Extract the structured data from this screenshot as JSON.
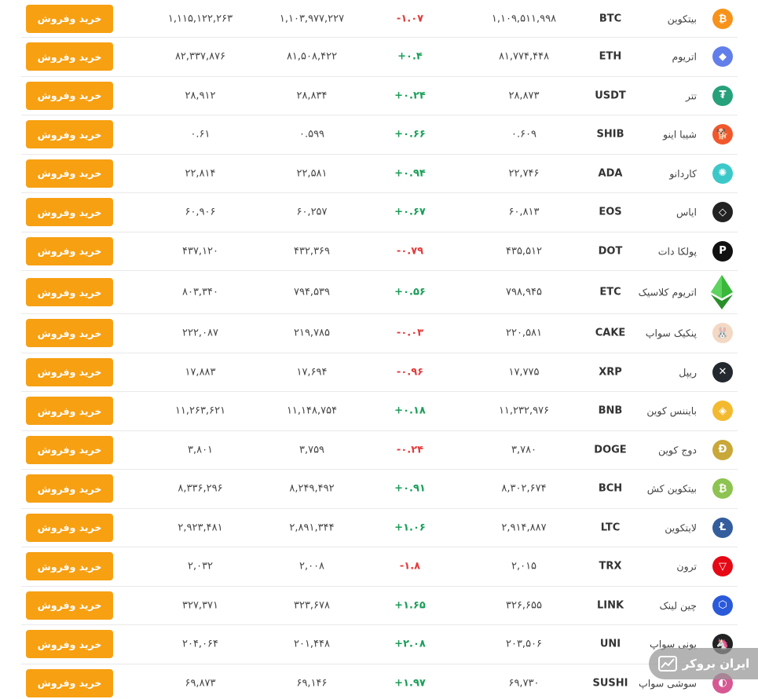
{
  "button_label": "خرید وفروش",
  "watermark": {
    "text": "ایران بروکر",
    "logo_icon": "chart-trend-icon"
  },
  "colors": {
    "accent": "#f7a012",
    "up": "#1a9e58",
    "down": "#e23b3b"
  },
  "rows": [
    {
      "name": "بیتکوین",
      "symbol": "BTC",
      "price": "۱,۱۰۹,۵۱۱,۹۹۸",
      "change": "-۱.۰۷",
      "trend": "down",
      "buy": "۱,۱۰۳,۹۷۷,۲۲۷",
      "sell": "۱,۱۱۵,۱۲۲,۲۶۳",
      "icon": "bitcoin-icon",
      "color": "#f7931a",
      "glyph": "₿"
    },
    {
      "name": "اتریوم",
      "symbol": "ETH",
      "price": "۸۱,۷۷۴,۴۴۸",
      "change": "+۰.۴",
      "trend": "up",
      "buy": "۸۱,۵۰۸,۴۲۲",
      "sell": "۸۲,۳۳۷,۸۷۶",
      "icon": "ethereum-icon",
      "color": "#627eea",
      "glyph": "◆"
    },
    {
      "name": "تتر",
      "symbol": "USDT",
      "price": "۲۸,۸۷۳",
      "change": "+۰.۲۴",
      "trend": "up",
      "buy": "۲۸,۸۳۴",
      "sell": "۲۸,۹۱۲",
      "icon": "tether-icon",
      "color": "#26a17b",
      "glyph": "₮"
    },
    {
      "name": "شیبا اینو",
      "symbol": "SHIB",
      "price": "۰.۶۰۹",
      "change": "+۰.۶۶",
      "trend": "up",
      "buy": "۰.۵۹۹",
      "sell": "۰.۶۱",
      "icon": "shiba-inu-icon",
      "color": "#f0582c",
      "glyph": "🐕"
    },
    {
      "name": "کاردانو",
      "symbol": "ADA",
      "price": "۲۲,۷۴۶",
      "change": "+۰.۹۴",
      "trend": "up",
      "buy": "۲۲,۵۸۱",
      "sell": "۲۲,۸۱۴",
      "icon": "cardano-icon",
      "color": "#3cc8c8",
      "glyph": "✺"
    },
    {
      "name": "ایاس",
      "symbol": "EOS",
      "price": "۶۰,۸۱۳",
      "change": "+۰.۶۷",
      "trend": "up",
      "buy": "۶۰,۲۵۷",
      "sell": "۶۰,۹۰۶",
      "icon": "eos-icon",
      "color": "#222222",
      "glyph": "◇"
    },
    {
      "name": "پولکا دات",
      "symbol": "DOT",
      "price": "۴۳۵,۵۱۲",
      "change": "-۰.۷۹",
      "trend": "down",
      "buy": "۴۳۲,۳۶۹",
      "sell": "۴۳۷,۱۲۰",
      "icon": "polkadot-icon",
      "color": "#111111",
      "glyph": "P"
    },
    {
      "name": "اتریوم کلاسیک",
      "symbol": "ETC",
      "price": "۷۹۸,۹۴۵",
      "change": "+۰.۵۶",
      "trend": "up",
      "buy": "۷۹۴,۵۳۹",
      "sell": "۸۰۳,۳۴۰",
      "icon": "ethereum-classic-icon",
      "color": "#3ab83a",
      "glyph": ""
    },
    {
      "name": "پنکیک سواپ",
      "symbol": "CAKE",
      "price": "۲۲۰,۵۸۱",
      "change": "-۰.۰۳",
      "trend": "down",
      "buy": "۲۱۹,۷۸۵",
      "sell": "۲۲۲,۰۸۷",
      "icon": "pancakeswap-icon",
      "color": "#f3d8c3",
      "glyph": "🐰"
    },
    {
      "name": "ریپل",
      "symbol": "XRP",
      "price": "۱۷,۷۷۵",
      "change": "-۰.۹۶",
      "trend": "down",
      "buy": "۱۷,۶۹۴",
      "sell": "۱۷,۸۸۳",
      "icon": "ripple-icon",
      "color": "#23292f",
      "glyph": "✕"
    },
    {
      "name": "بایننس کوین",
      "symbol": "BNB",
      "price": "۱۱,۲۳۲,۹۷۶",
      "change": "+۰.۱۸",
      "trend": "up",
      "buy": "۱۱,۱۴۸,۷۵۴",
      "sell": "۱۱,۲۶۳,۶۲۱",
      "icon": "binance-icon",
      "color": "#f3ba2f",
      "glyph": "◈"
    },
    {
      "name": "دوج کوین",
      "symbol": "DOGE",
      "price": "۳,۷۸۰",
      "change": "-۰.۲۴",
      "trend": "down",
      "buy": "۳,۷۵۹",
      "sell": "۳,۸۰۱",
      "icon": "dogecoin-icon",
      "color": "#c9a83a",
      "glyph": "Ð"
    },
    {
      "name": "بیتکوین کش",
      "symbol": "BCH",
      "price": "۸,۳۰۲,۶۷۴",
      "change": "+۰.۹۱",
      "trend": "up",
      "buy": "۸,۲۴۹,۴۹۲",
      "sell": "۸,۳۳۶,۲۹۶",
      "icon": "bitcoin-cash-icon",
      "color": "#8dc351",
      "glyph": "₿"
    },
    {
      "name": "لایتکوین",
      "symbol": "LTC",
      "price": "۲,۹۱۴,۸۸۷",
      "change": "+۱.۰۶",
      "trend": "up",
      "buy": "۲,۸۹۱,۳۴۴",
      "sell": "۲,۹۲۳,۴۸۱",
      "icon": "litecoin-icon",
      "color": "#345d9d",
      "glyph": "Ł"
    },
    {
      "name": "ترون",
      "symbol": "TRX",
      "price": "۲,۰۱۵",
      "change": "-۱.۸",
      "trend": "down",
      "buy": "۲,۰۰۸",
      "sell": "۲,۰۳۲",
      "icon": "tron-icon",
      "color": "#e50915",
      "glyph": "▽"
    },
    {
      "name": "چین لینک",
      "symbol": "LINK",
      "price": "۳۲۶,۶۵۵",
      "change": "+۱.۶۵",
      "trend": "up",
      "buy": "۳۲۳,۶۷۸",
      "sell": "۳۲۷,۳۷۱",
      "icon": "chainlink-icon",
      "color": "#2a5ada",
      "glyph": "⬡"
    },
    {
      "name": "یونی سواپ",
      "symbol": "UNI",
      "price": "۲۰۳,۵۰۶",
      "change": "+۲.۰۸",
      "trend": "up",
      "buy": "۲۰۱,۴۴۸",
      "sell": "۲۰۴,۰۶۴",
      "icon": "uniswap-icon",
      "color": "#222222",
      "glyph": "🦄"
    },
    {
      "name": "سوشی سواپ",
      "symbol": "SUSHI",
      "price": "۶۹,۷۳۰",
      "change": "+۱.۹۷",
      "trend": "up",
      "buy": "۶۹,۱۴۶",
      "sell": "۶۹,۸۷۳",
      "icon": "sushiswap-icon",
      "color": "#d65892",
      "glyph": "◐"
    }
  ]
}
